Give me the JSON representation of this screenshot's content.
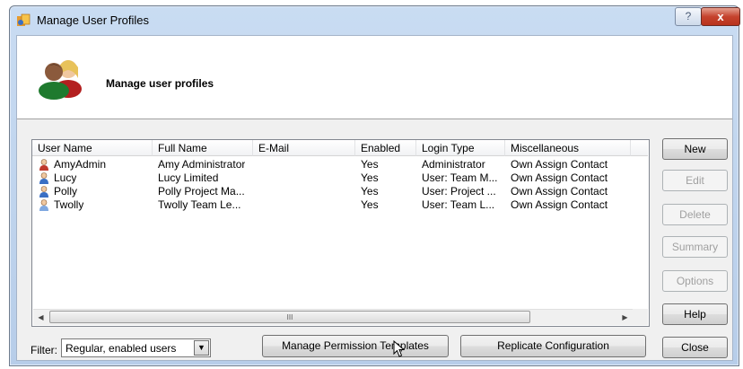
{
  "window": {
    "title": "Manage User Profiles",
    "help_glyph": "?",
    "close_glyph": "x"
  },
  "header": {
    "title": "Manage user profiles"
  },
  "list": {
    "columns": [
      "User Name",
      "Full Name",
      "E-Mail",
      "Enabled",
      "Login Type",
      "Miscellaneous"
    ],
    "rows": [
      {
        "icon": "admin-user-icon",
        "user": "AmyAdmin",
        "full": "Amy Administrator",
        "email": "",
        "enabled": "Yes",
        "login": "Administrator",
        "misc": "Own Assign Contact"
      },
      {
        "icon": "user-icon",
        "user": "Lucy",
        "full": "Lucy Limited",
        "email": "",
        "enabled": "Yes",
        "login": "User: Team M...",
        "misc": "Own Assign Contact"
      },
      {
        "icon": "user-icon",
        "user": "Polly",
        "full": "Polly Project Ma...",
        "email": "",
        "enabled": "Yes",
        "login": "User: Project ...",
        "misc": "Own Assign Contact"
      },
      {
        "icon": "user-icon",
        "user": "Twolly",
        "full": "Twolly Team Le...",
        "email": "",
        "enabled": "Yes",
        "login": "User: Team L...",
        "misc": "Own Assign Contact"
      }
    ]
  },
  "scroll": {
    "left_glyph": "◀",
    "right_glyph": "▶",
    "thumb_grip": "III"
  },
  "buttons": {
    "new": "New",
    "edit": "Edit",
    "delete": "Delete",
    "summary": "Summary",
    "options": "Options",
    "help": "Help",
    "close": "Close",
    "manage_templates": "Manage Permission Templates",
    "replicate": "Replicate Configuration"
  },
  "filter": {
    "label": "Filter:",
    "value": "Regular, enabled users",
    "arrow_glyph": "▼"
  },
  "colors": {
    "admin_icon": "#c0392b",
    "user_icon": "#3a6fc4",
    "user_icon_light": "#7fa8e0",
    "accent": "#b7cde9"
  }
}
